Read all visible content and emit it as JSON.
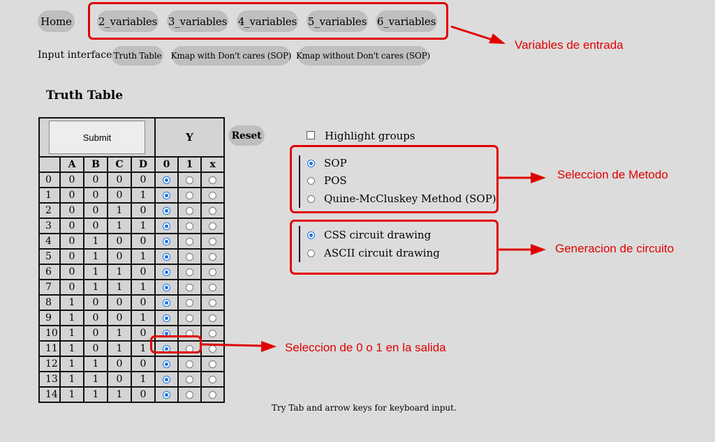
{
  "nav": {
    "home": "Home",
    "variables": [
      "2_variables",
      "3_variables",
      "4_variables",
      "5_variables",
      "6_variables"
    ]
  },
  "input_interface": {
    "label": "Input interface",
    "options": [
      "Truth Table",
      "Kmap with Don't cares (SOP)",
      "Kmap without Don't cares (SOP)"
    ]
  },
  "truth_table": {
    "title": "Truth Table",
    "submit_label": "Submit",
    "output_label": "Y",
    "columns": [
      "A",
      "B",
      "C",
      "D"
    ],
    "output_options": [
      "0",
      "1",
      "x"
    ],
    "rows": [
      {
        "index": "0",
        "bits": [
          "0",
          "0",
          "0",
          "0"
        ],
        "selected": "0"
      },
      {
        "index": "1",
        "bits": [
          "0",
          "0",
          "0",
          "1"
        ],
        "selected": "0"
      },
      {
        "index": "2",
        "bits": [
          "0",
          "0",
          "1",
          "0"
        ],
        "selected": "0"
      },
      {
        "index": "3",
        "bits": [
          "0",
          "0",
          "1",
          "1"
        ],
        "selected": "0"
      },
      {
        "index": "4",
        "bits": [
          "0",
          "1",
          "0",
          "0"
        ],
        "selected": "0"
      },
      {
        "index": "5",
        "bits": [
          "0",
          "1",
          "0",
          "1"
        ],
        "selected": "0"
      },
      {
        "index": "6",
        "bits": [
          "0",
          "1",
          "1",
          "0"
        ],
        "selected": "0"
      },
      {
        "index": "7",
        "bits": [
          "0",
          "1",
          "1",
          "1"
        ],
        "selected": "0"
      },
      {
        "index": "8",
        "bits": [
          "1",
          "0",
          "0",
          "0"
        ],
        "selected": "0"
      },
      {
        "index": "9",
        "bits": [
          "1",
          "0",
          "0",
          "1"
        ],
        "selected": "0"
      },
      {
        "index": "10",
        "bits": [
          "1",
          "0",
          "1",
          "0"
        ],
        "selected": "0"
      },
      {
        "index": "11",
        "bits": [
          "1",
          "0",
          "1",
          "1"
        ],
        "selected": "0"
      },
      {
        "index": "12",
        "bits": [
          "1",
          "1",
          "0",
          "0"
        ],
        "selected": "0"
      },
      {
        "index": "13",
        "bits": [
          "1",
          "1",
          "0",
          "1"
        ],
        "selected": "0"
      },
      {
        "index": "14",
        "bits": [
          "1",
          "1",
          "1",
          "0"
        ],
        "selected": "0"
      }
    ]
  },
  "controls": {
    "reset_label": "Reset",
    "highlight_groups": "Highlight groups",
    "methods": [
      "SOP",
      "POS",
      "Quine-McCluskey Method (SOP)"
    ],
    "selected_method": "SOP",
    "drawings": [
      "CSS circuit drawing",
      "ASCII circuit drawing"
    ],
    "selected_drawing": "CSS circuit drawing",
    "hint": "Try Tab and arrow keys for keyboard input."
  },
  "annotations": {
    "variables": "Variables de entrada",
    "method": "Seleccion de Metodo",
    "circuit": "Generacion de circuito",
    "output": "Seleccion de 0 o 1 en la salida",
    "color": "#e00000"
  },
  "colors": {
    "background": "#dcdcdc",
    "pill": "#bfbfbf",
    "radio_selected": "#1a73e8"
  }
}
